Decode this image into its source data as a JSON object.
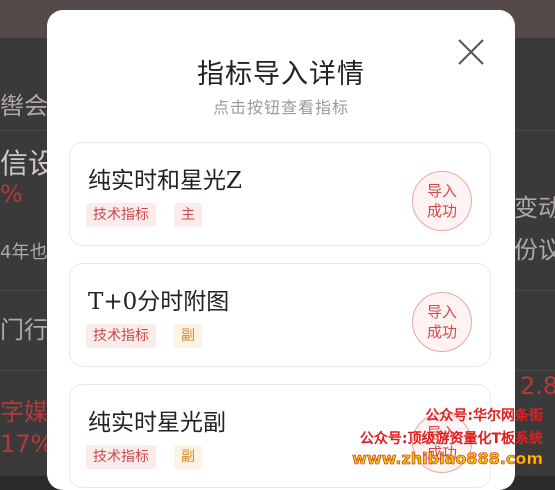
{
  "background": {
    "left_texts": [
      "辔会议",
      "信设",
      "%",
      "4年也",
      "门行业",
      "字媒体",
      "17%"
    ],
    "right_texts": [
      "变动",
      "份议",
      "2.8"
    ]
  },
  "modal": {
    "title": "指标导入详情",
    "subtitle": "点击按钮查看指标",
    "cards": [
      {
        "name": "纯实时和星光Z",
        "type_tag": "技术指标",
        "role_tag": "主",
        "status_line1": "导入",
        "status_line2": "成功"
      },
      {
        "name": "T+0分时附图",
        "type_tag": "技术指标",
        "role_tag": "副",
        "status_line1": "导入",
        "status_line2": "成功"
      },
      {
        "name": "纯实时星光副",
        "type_tag": "技术指标",
        "role_tag": "副",
        "status_line1": "导入",
        "status_line2": "成功"
      }
    ]
  },
  "watermark": {
    "line1": "公众号:华尔网条街",
    "line2": "公众号:顶级游资量化T板系统",
    "line3": "www.zhibiao888.com"
  }
}
